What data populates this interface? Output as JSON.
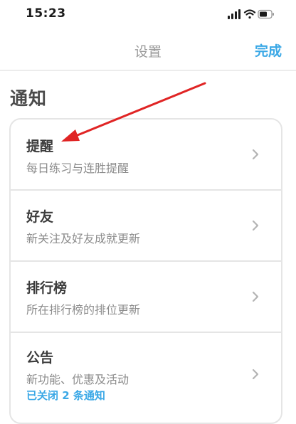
{
  "status_bar": {
    "time": "15:23"
  },
  "nav": {
    "title": "设置",
    "done_label": "完成"
  },
  "section": {
    "title": "通知"
  },
  "rows": [
    {
      "title": "提醒",
      "subtitle": "每日练习与连胜提醒"
    },
    {
      "title": "好友",
      "subtitle": "新关注及好友成就更新"
    },
    {
      "title": "排行榜",
      "subtitle": "所在排行榜的排位更新"
    },
    {
      "title": "公告",
      "subtitle": "新功能、优惠及活动",
      "extra": "已关闭 2 条通知"
    }
  ],
  "colors": {
    "accent": "#3ba8e6",
    "annotation_arrow": "#e02424"
  }
}
